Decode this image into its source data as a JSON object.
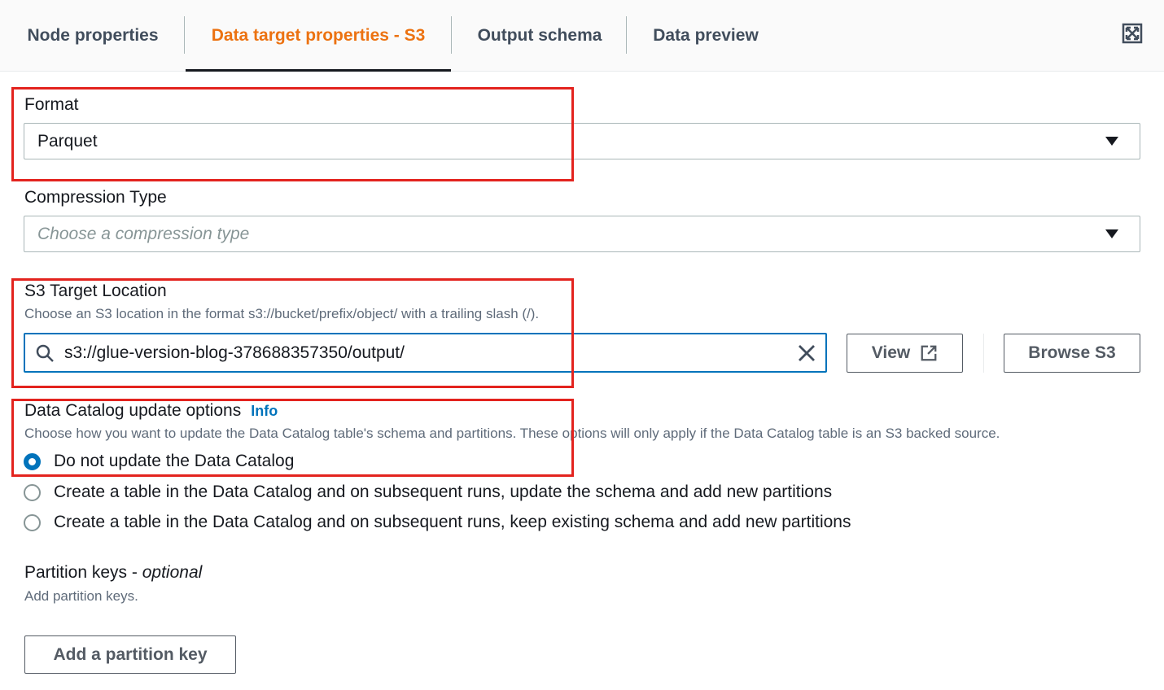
{
  "tabs": [
    {
      "label": "Node properties",
      "active": false
    },
    {
      "label": "Data target properties - S3",
      "active": true
    },
    {
      "label": "Output schema",
      "active": false
    },
    {
      "label": "Data preview",
      "active": false
    }
  ],
  "format": {
    "label": "Format",
    "value": "Parquet"
  },
  "compression": {
    "label": "Compression Type",
    "placeholder": "Choose a compression type"
  },
  "s3_target": {
    "label": "S3 Target Location",
    "description": "Choose an S3 location in the format s3://bucket/prefix/object/ with a trailing slash (/).",
    "value": "s3://glue-version-blog-378688357350/output/",
    "view_button": "View",
    "browse_button": "Browse S3"
  },
  "catalog": {
    "label": "Data Catalog update options",
    "info_link": "Info",
    "description": "Choose how you want to update the Data Catalog table's schema and partitions. These options will only apply if the Data Catalog table is an S3 backed source.",
    "options": [
      {
        "label": "Do not update the Data Catalog",
        "selected": true
      },
      {
        "label": "Create a table in the Data Catalog and on subsequent runs, update the schema and add new partitions",
        "selected": false
      },
      {
        "label": "Create a table in the Data Catalog and on subsequent runs, keep existing schema and add new partitions",
        "selected": false
      }
    ]
  },
  "partition": {
    "label": "Partition keys",
    "optional": "optional",
    "description": "Add partition keys.",
    "button": "Add a partition key"
  },
  "colors": {
    "accent": "#ec7211",
    "link": "#0073bb",
    "highlight": "#e3231e"
  }
}
